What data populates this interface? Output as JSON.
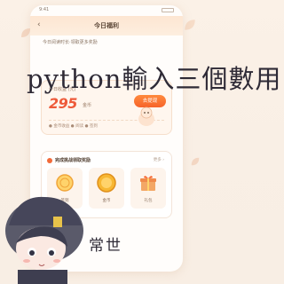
{
  "status": {
    "time": "9:41"
  },
  "header": {
    "title": "今日福利",
    "back_icon": "chevron-left-icon"
  },
  "lead_text": "今日阅读时长·领取更多奖励",
  "earnings": {
    "label": "今日收益 (元)",
    "amount": "295",
    "unit": "金币",
    "cash_button": "去提现",
    "stats": [
      "● 金币收益 ● 阅读 ● 签到"
    ]
  },
  "tasks": {
    "title": "完成挑战领取奖励",
    "more": "更多 ›",
    "items": [
      {
        "name": "签到",
        "icon": "coin-icon"
      },
      {
        "name": "金币",
        "icon": "gold-coin-icon"
      },
      {
        "name": "礼包",
        "icon": "gift-box-icon"
      }
    ]
  },
  "overlay": {
    "line1": "python輸入三個數用",
    "line2": "常世"
  },
  "colors": {
    "accent": "#f6632a",
    "amount": "#ee5a3a",
    "background": "#f9efe5"
  }
}
